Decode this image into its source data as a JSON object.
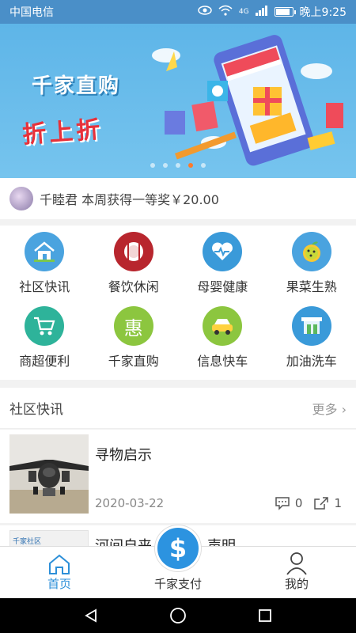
{
  "status_bar": {
    "carrier": "中国电信",
    "network": "4G",
    "time": "晚上9:25"
  },
  "banner": {
    "title": "千家直购",
    "promo": "折上折",
    "carousel": {
      "count": 5,
      "active_index": 3
    }
  },
  "notice": {
    "text": "千睦君 本周获得一等奖￥20.00"
  },
  "categories": [
    {
      "label": "社区快讯",
      "icon": "house-icon",
      "color": "#4aa3df"
    },
    {
      "label": "餐饮休闲",
      "icon": "fork-knife-icon",
      "color": "#b8262e"
    },
    {
      "label": "母婴健康",
      "icon": "heart-pulse-icon",
      "color": "#3a9ad9"
    },
    {
      "label": "果菜生熟",
      "icon": "fruit-icon",
      "color": "#4aa3df"
    },
    {
      "label": "商超便利",
      "icon": "cart-icon",
      "color": "#2eb39a"
    },
    {
      "label": "千家直购",
      "icon": "hui-icon",
      "color": "#8cc63f"
    },
    {
      "label": "信息快车",
      "icon": "car-icon",
      "color": "#8cc63f"
    },
    {
      "label": "加油洗车",
      "icon": "gas-station-icon",
      "color": "#3a9ad9"
    }
  ],
  "news": {
    "section_title": "社区快讯",
    "more_label": "更多",
    "items": [
      {
        "title": "寻物启示",
        "date": "2020-03-22",
        "comments": "0",
        "shares": "1"
      },
      {
        "title": "河间自来",
        "title_tail": "声明",
        "thumb_caption": "千家社区"
      }
    ]
  },
  "bottom_nav": {
    "home": "首页",
    "pay": "千家支付",
    "pay_symbol": "$",
    "profile": "我的"
  },
  "colors": {
    "accent": "#2c8fd8",
    "status_bar": "#4a8fc8",
    "banner": "#5eb5e8"
  }
}
